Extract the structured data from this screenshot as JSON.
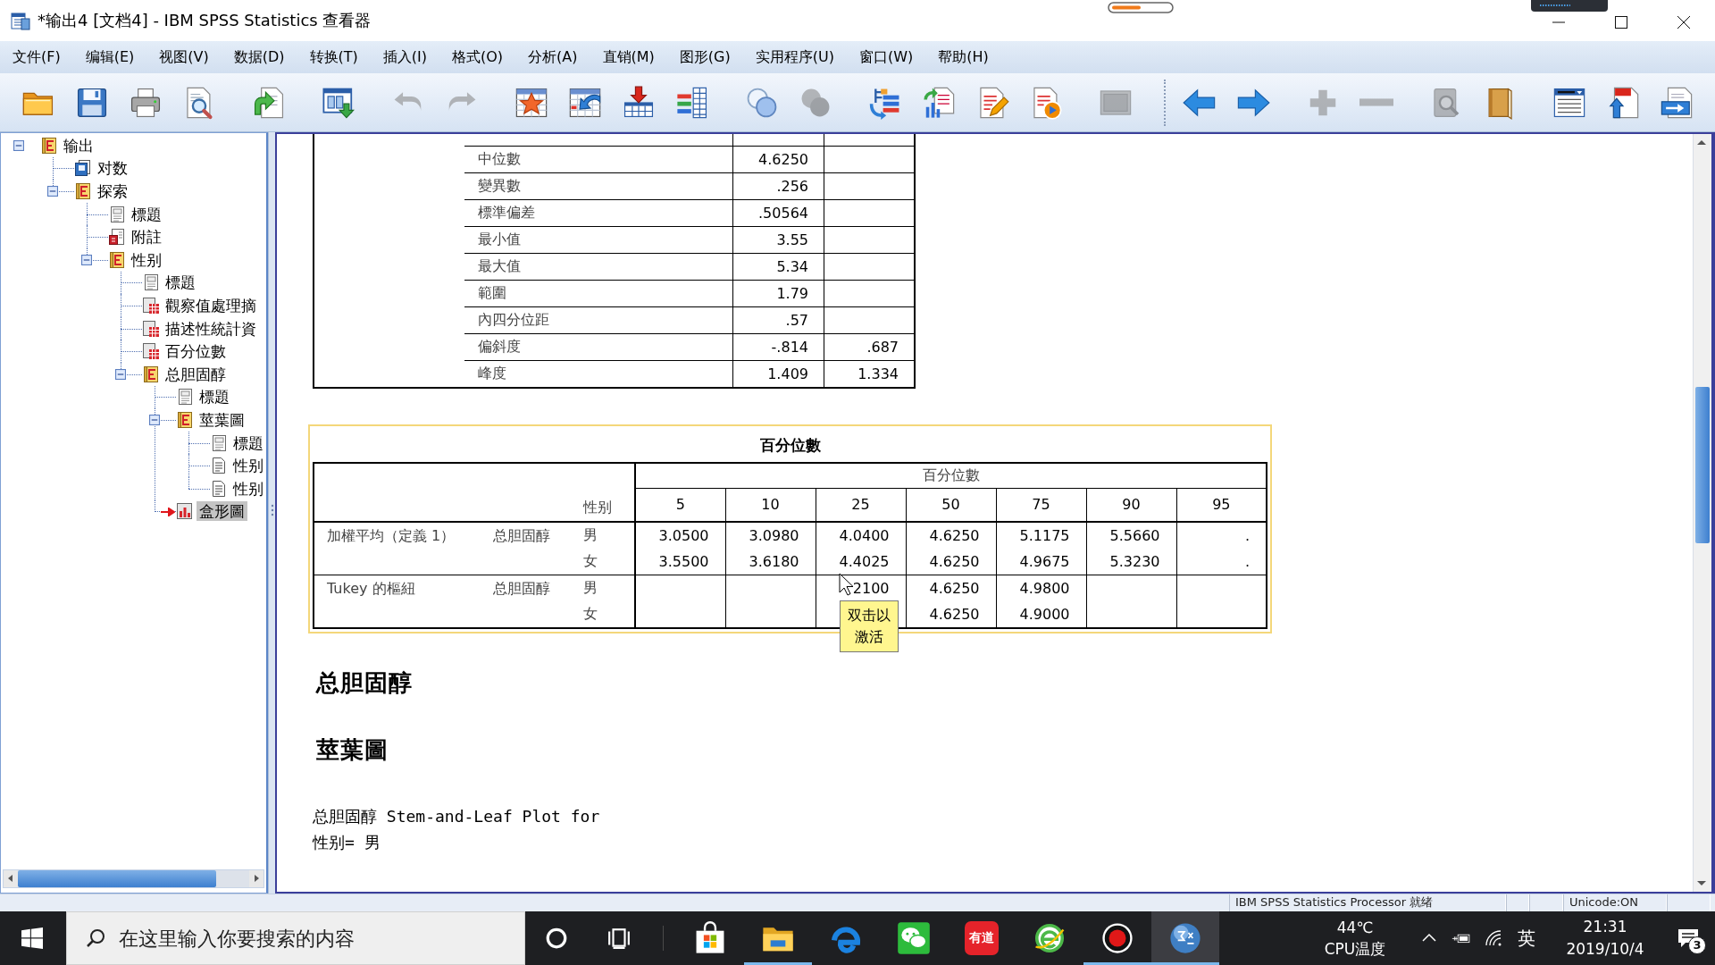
{
  "window": {
    "title": "*输出4 [文档4] - IBM SPSS Statistics 查看器"
  },
  "menu": [
    "文件(F)",
    "编辑(E)",
    "视图(V)",
    "数据(D)",
    "转换(T)",
    "插入(I)",
    "格式(O)",
    "分析(A)",
    "直销(M)",
    "图形(G)",
    "实用程序(U)",
    "窗口(W)",
    "帮助(H)"
  ],
  "toolbars": [
    {
      "groups": [
        {
          "buttons": [
            {
              "kind": "folder",
              "disabled": false
            },
            {
              "kind": "save",
              "disabled": false
            },
            {
              "kind": "print",
              "disabled": false
            },
            {
              "kind": "preview",
              "disabled": false
            }
          ]
        },
        {
          "buttons": [
            {
              "kind": "export",
              "disabled": false
            }
          ]
        },
        {
          "buttons": [
            {
              "kind": "recall",
              "disabled": false
            }
          ]
        },
        {
          "buttons": [
            {
              "kind": "undo",
              "disabled": true
            },
            {
              "kind": "redo",
              "disabled": true
            }
          ]
        },
        {
          "buttons": [
            {
              "kind": "goto_data",
              "disabled": false
            },
            {
              "kind": "goto_case",
              "disabled": false
            },
            {
              "kind": "insert",
              "disabled": false
            },
            {
              "kind": "variables",
              "disabled": false
            }
          ]
        },
        {
          "buttons": [
            {
              "kind": "circles",
              "disabled": false
            },
            {
              "kind": "filled_circles",
              "disabled": true
            }
          ]
        },
        {
          "buttons": [
            {
              "kind": "tree",
              "disabled": false
            },
            {
              "kind": "chart_doc",
              "disabled": false
            },
            {
              "kind": "doc_edit",
              "disabled": false
            },
            {
              "kind": "doc_play",
              "disabled": false
            }
          ]
        },
        {
          "buttons": [
            {
              "kind": "frame",
              "disabled": true
            }
          ]
        }
      ]
    },
    {
      "groups": [
        {
          "buttons": [
            {
              "kind": "back",
              "disabled": false
            },
            {
              "kind": "forward",
              "disabled": false
            }
          ]
        },
        {
          "buttons": [
            {
              "kind": "expand",
              "disabled": true
            },
            {
              "kind": "collapse",
              "disabled": true
            }
          ]
        },
        {
          "buttons": [
            {
              "kind": "book_search",
              "disabled": true
            },
            {
              "kind": "book",
              "disabled": false
            }
          ]
        },
        {
          "buttons": [
            {
              "kind": "list",
              "disabled": false
            },
            {
              "kind": "doc_up",
              "disabled": false
            },
            {
              "kind": "doc_send",
              "disabled": false
            }
          ]
        }
      ]
    }
  ],
  "outline": {
    "items": [
      {
        "label": "输出",
        "kind": "heading",
        "expanded": true,
        "selected": false,
        "children": [
          {
            "label": "对数",
            "kind": "log",
            "selected": false
          },
          {
            "label": "探索",
            "kind": "heading",
            "expanded": true,
            "selected": false,
            "children": [
              {
                "label": "標題",
                "kind": "title",
                "selected": false
              },
              {
                "label": "附註",
                "kind": "notes",
                "selected": false
              },
              {
                "label": "性别",
                "kind": "heading",
                "expanded": true,
                "selected": false,
                "children": [
                  {
                    "label": "標題",
                    "kind": "title",
                    "selected": false
                  },
                  {
                    "label": "觀察值處理摘",
                    "kind": "table",
                    "selected": false
                  },
                  {
                    "label": "描述性統計資",
                    "kind": "table",
                    "selected": false
                  },
                  {
                    "label": "百分位數",
                    "kind": "table",
                    "selected": false
                  },
                  {
                    "label": "总胆固醇",
                    "kind": "heading",
                    "expanded": true,
                    "selected": false,
                    "children": [
                      {
                        "label": "標題",
                        "kind": "title",
                        "selected": false
                      },
                      {
                        "label": "莖葉圖",
                        "kind": "heading",
                        "expanded": true,
                        "selected": false,
                        "children": [
                          {
                            "label": "標題",
                            "kind": "title",
                            "selected": false
                          },
                          {
                            "label": "性别",
                            "kind": "text",
                            "selected": false
                          },
                          {
                            "label": "性别",
                            "kind": "text",
                            "selected": false
                          }
                        ]
                      },
                      {
                        "label": "盒形圖",
                        "kind": "chart",
                        "selected": true
                      }
                    ]
                  }
                ]
              }
            ]
          }
        ]
      }
    ]
  },
  "output": {
    "items": [
      {
        "kind": "statistics_fragment",
        "selected": false,
        "rows": [
          {
            "column_1": "中位數",
            "column_2": "4.6250"
          },
          {
            "column_1": "變異數",
            "column_2": ".256"
          },
          {
            "column_1": "標準偏差",
            "column_2": ".50564"
          },
          {
            "column_1": "最小值",
            "column_2": "3.55"
          },
          {
            "column_1": "最大值",
            "column_2": "5.34"
          },
          {
            "column_1": "範圍",
            "column_2": "1.79"
          },
          {
            "column_1": "內四分位距",
            "column_2": ".57"
          },
          {
            "column_1": "偏斜度",
            "column_2": "-.814",
            "column_3": ".687"
          },
          {
            "column_1": "峰度",
            "column_2": "1.409",
            "column_3": "1.334"
          }
        ]
      },
      {
        "kind": "percentiles",
        "selected": true,
        "title": "百分位數",
        "spanner": "百分位數",
        "row_header": "性别",
        "columns": [
          "5",
          "10",
          "25",
          "50",
          "75",
          "90",
          "95"
        ],
        "groups": [
          {
            "method": "加權平均（定義 1）",
            "variable": "总胆固醇",
            "rows": [
              {
                "label": "男",
                "cells": [
                  "3.0500",
                  "3.0980",
                  "4.0400",
                  "4.6250",
                  "5.1175",
                  "5.5660",
                  "."
                ]
              },
              {
                "label": "女",
                "cells": [
                  "3.5500",
                  "3.6180",
                  "4.4025",
                  "4.6250",
                  "4.9675",
                  "5.3230",
                  "."
                ]
              }
            ]
          },
          {
            "method": "Tukey 的樞紐",
            "variable": "总胆固醇",
            "rows": [
              {
                "label": "男",
                "cells": [
                  null,
                  null,
                  "2100",
                  "4.6250",
                  "4.9800",
                  null,
                  null
                ]
              },
              {
                "label": "女",
                "cells": [
                  null,
                  null,
                  null,
                  "4.6250",
                  "4.9000",
                  null,
                  null
                ]
              }
            ]
          }
        ]
      },
      {
        "kind": "heading",
        "selected": false,
        "text": "总胆固醇"
      },
      {
        "kind": "heading",
        "selected": false,
        "text": "莖葉圖"
      },
      {
        "kind": "text",
        "selected": false,
        "lines": [
          "总胆固醇 Stem-and-Leaf Plot for",
          "性别= 男"
        ]
      }
    ]
  },
  "tooltip": {
    "text": "双击以激活"
  },
  "status_bar": {
    "processor": "IBM SPSS Statistics Processor 就绪",
    "unicode": "Unicode:ON"
  },
  "taskbar": {
    "search": {
      "placeholder": "在这里输入你要搜索的内容"
    },
    "apps": [
      {
        "kind": "store",
        "running": false,
        "active": false
      },
      {
        "kind": "explorer",
        "running": true,
        "active": false
      },
      {
        "kind": "edge",
        "running": false,
        "active": false
      },
      {
        "kind": "wechat",
        "running": false,
        "active": false
      },
      {
        "kind": "youdao",
        "label": "有道",
        "running": false,
        "active": false
      },
      {
        "kind": "browser",
        "running": false,
        "active": false
      },
      {
        "kind": "recorder",
        "running": true,
        "active": false
      },
      {
        "kind": "spss",
        "running": true,
        "active": true
      }
    ],
    "temperature": {
      "value": "44℃",
      "label": "CPU温度"
    },
    "input_method": "英",
    "clock": {
      "time": "21:31",
      "date": "2019/10/4"
    },
    "notifications": {
      "count": "3"
    }
  }
}
